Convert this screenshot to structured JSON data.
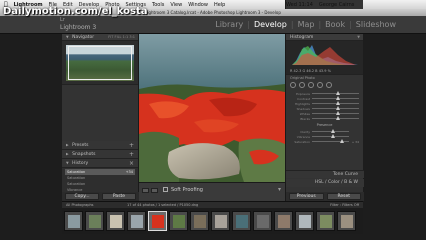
{
  "watermark": "Dailymotion.com/el_kosta",
  "menubar": {
    "app": "Lightroom",
    "items": [
      "File",
      "Edit",
      "Develop",
      "Photo",
      "Settings",
      "Tools",
      "View",
      "Window",
      "Help"
    ],
    "time": "Wed 11:14",
    "user": "George Cairns"
  },
  "window_title": "Lightroom 3 Catalog.lrcat - Adobe Photoshop Lightroom 3 - Develop",
  "identity": {
    "logo": "Lr",
    "title": "Lightroom 3"
  },
  "modules": [
    "Library",
    "Develop",
    "Map",
    "Book",
    "Slideshow"
  ],
  "active_module": "Develop",
  "left_panel": {
    "navigator": {
      "title": "Navigator",
      "zoom_options": "FIT  FILL  1:1  3:1"
    },
    "presets": "Presets",
    "snapshots": "Snapshots",
    "history": "History",
    "history_items": [
      {
        "label": "Saturation",
        "value": "+34",
        "selected": true
      },
      {
        "label": "Saturation",
        "value": ""
      },
      {
        "label": "Saturation",
        "value": ""
      },
      {
        "label": "Vibrance",
        "value": ""
      },
      {
        "label": "Saturation",
        "value": ""
      },
      {
        "label": "Vibrance",
        "value": ""
      },
      {
        "label": "Vibrance",
        "value": ""
      }
    ],
    "copy_button": "Copy...",
    "paste_button": "Paste"
  },
  "toolbar": {
    "soft_proofing": "Soft Proofing"
  },
  "right_panel": {
    "histogram": "Histogram",
    "histo_info": "R  42.3  G  46.2  B  43.9 %",
    "original_photo": "Original Photo",
    "sliders": [
      {
        "label": "Exposure"
      },
      {
        "label": "Contrast"
      },
      {
        "label": "Highlights"
      },
      {
        "label": "Shadows"
      },
      {
        "label": "Whites"
      },
      {
        "label": "Blacks"
      }
    ],
    "presence": "Presence",
    "presence_sliders": [
      {
        "label": "Clarity",
        "value": ""
      },
      {
        "label": "Vibrance",
        "value": ""
      },
      {
        "label": "Saturation",
        "value": "+ 34"
      }
    ],
    "tone_curve": "Tone Curve",
    "hsl": "HSL  /  Color  /  B & W",
    "previous_button": "Previous",
    "reset_button": "Reset"
  },
  "filmstrip": {
    "info": "All Photographs",
    "count": "17 of 44 photos / 1 selected / P1050.dng",
    "filter": "Filter :",
    "filter_value": "Filters Off",
    "thumb_count": 14,
    "selected_index": 4
  },
  "colors": {
    "accent_red": "#d6321e",
    "panel": "#333333"
  }
}
